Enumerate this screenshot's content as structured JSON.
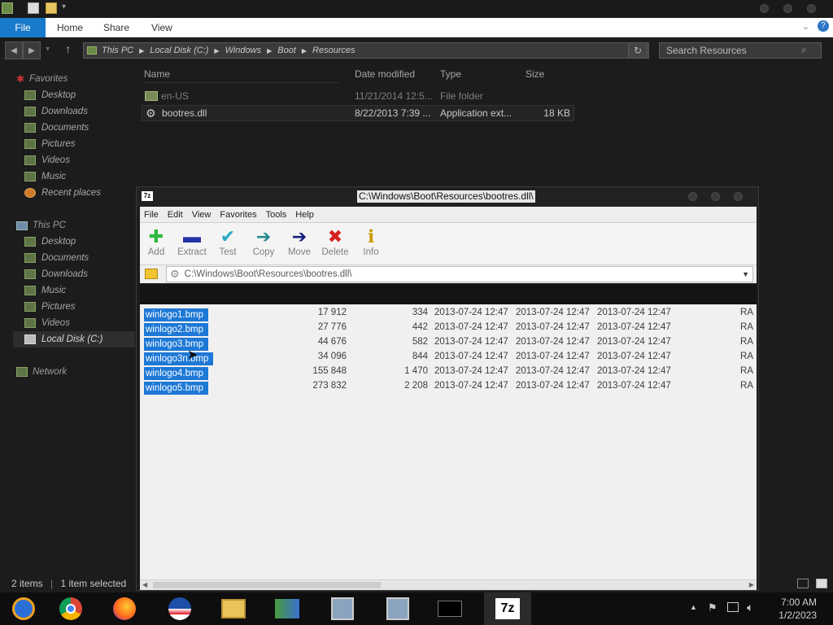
{
  "explorer": {
    "ribbon": {
      "file": "File",
      "home": "Home",
      "share": "Share",
      "view": "View"
    },
    "breadcrumb": [
      "This PC",
      "Local Disk (C:)",
      "Windows",
      "Boot",
      "Resources"
    ],
    "search_placeholder": "Search Resources",
    "nav": {
      "favorites": "Favorites",
      "fav_items": [
        "Desktop",
        "Downloads",
        "Documents",
        "Pictures",
        "Videos",
        "Music",
        "Recent places"
      ],
      "this_pc": "This PC",
      "pc_items": [
        "Desktop",
        "Documents",
        "Downloads",
        "Music",
        "Pictures",
        "Videos",
        "Local Disk (C:)"
      ],
      "network": "Network"
    },
    "columns": {
      "name": "Name",
      "date": "Date modified",
      "type": "Type",
      "size": "Size"
    },
    "files": [
      {
        "name": "en-US",
        "date": "11/21/2014 12:5...",
        "type": "File folder",
        "size": ""
      },
      {
        "name": "bootres.dll",
        "date": "8/22/2013 7:39 ...",
        "type": "Application ext...",
        "size": "18 KB"
      }
    ],
    "status": {
      "count": "2 items",
      "selected": "1 item selected"
    }
  },
  "zip": {
    "title": "C:\\Windows\\Boot\\Resources\\bootres.dll\\",
    "menu": [
      "File",
      "Edit",
      "View",
      "Favorites",
      "Tools",
      "Help"
    ],
    "toolbar": [
      "Add",
      "Extract",
      "Test",
      "Copy",
      "Move",
      "Delete",
      "Info"
    ],
    "path": "C:\\Windows\\Boot\\Resources\\bootres.dll\\",
    "rows": [
      {
        "name": "winlogo1.bmp",
        "size": "17 912",
        "packed": "334",
        "modified": "2013-07-24 12:47",
        "created": "2013-07-24 12:47",
        "accessed": "2013-07-24 12:47",
        "attr": "RA"
      },
      {
        "name": "winlogo2.bmp",
        "size": "27 776",
        "packed": "442",
        "modified": "2013-07-24 12:47",
        "created": "2013-07-24 12:47",
        "accessed": "2013-07-24 12:47",
        "attr": "RA"
      },
      {
        "name": "winlogo3.bmp",
        "size": "44 676",
        "packed": "582",
        "modified": "2013-07-24 12:47",
        "created": "2013-07-24 12:47",
        "accessed": "2013-07-24 12:47",
        "attr": "RA"
      },
      {
        "name": "winlogo3n.bmp",
        "size": "34 096",
        "packed": "844",
        "modified": "2013-07-24 12:47",
        "created": "2013-07-24 12:47",
        "accessed": "2013-07-24 12:47",
        "attr": "RA"
      },
      {
        "name": "winlogo4.bmp",
        "size": "155 848",
        "packed": "1 470",
        "modified": "2013-07-24 12:47",
        "created": "2013-07-24 12:47",
        "accessed": "2013-07-24 12:47",
        "attr": "RA"
      },
      {
        "name": "winlogo5.bmp",
        "size": "273 832",
        "packed": "2 208",
        "modified": "2013-07-24 12:47",
        "created": "2013-07-24 12:47",
        "accessed": "2013-07-24 12:47",
        "attr": "RA"
      }
    ]
  },
  "taskbar": {
    "apps": [
      "media-player-icon",
      "chrome-icon",
      "firefox-icon",
      "obama-logo-icon",
      "file-explorer-icon",
      "network-people-icon",
      "installer-icon",
      "installer2-icon",
      "terminal-icon",
      "7zip-icon"
    ],
    "time": "7:00 AM",
    "date": "1/2/2023"
  },
  "colors": {
    "accent": "#1979ca",
    "selection": "#1d78d6",
    "bg": "#1c1c1c"
  }
}
